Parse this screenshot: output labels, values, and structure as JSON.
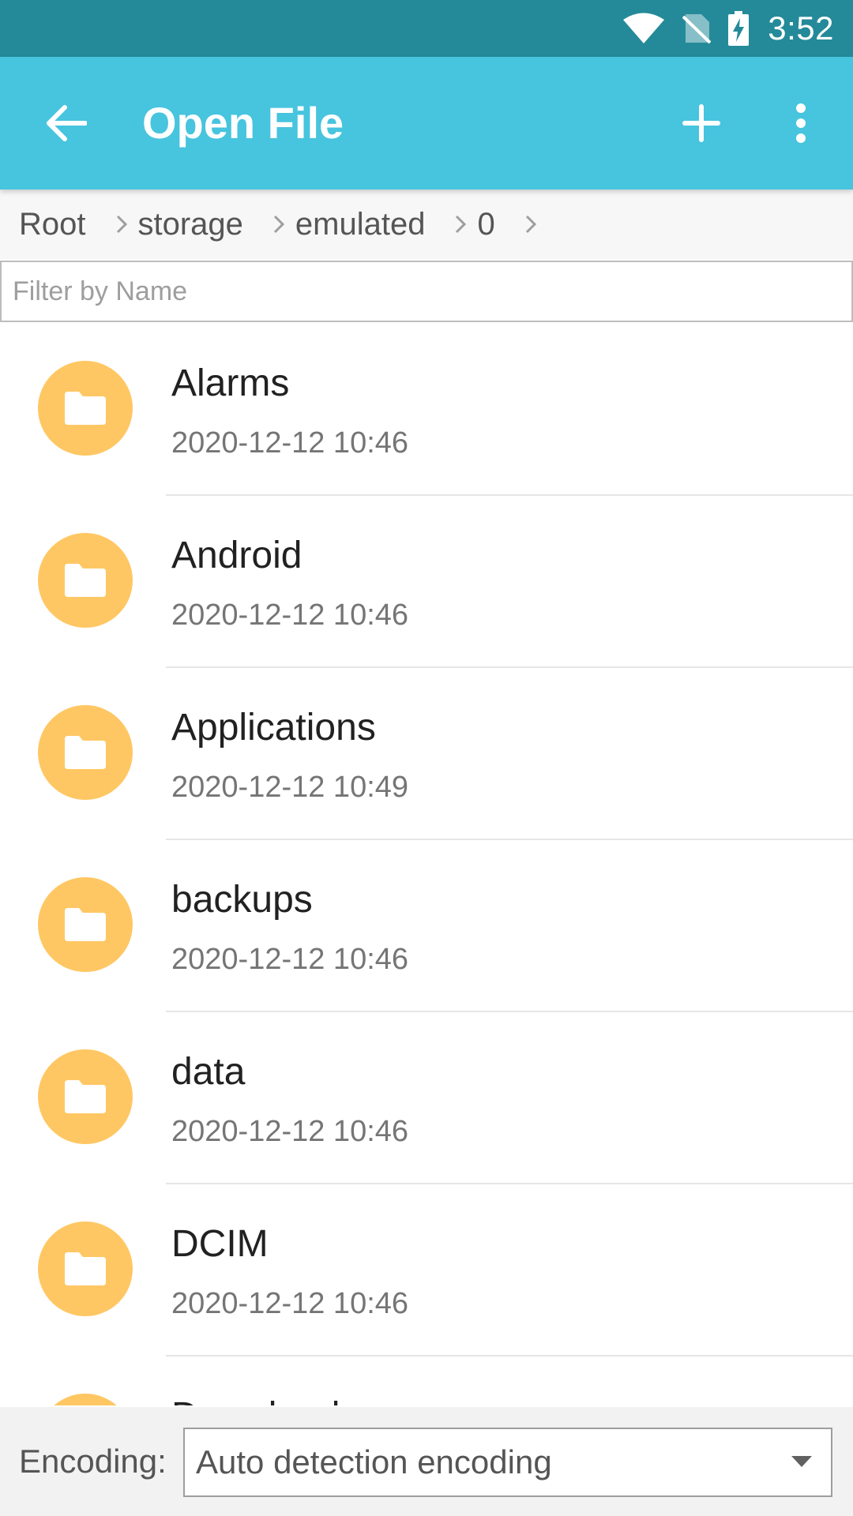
{
  "status_bar": {
    "time": "3:52",
    "icons": [
      "wifi-icon",
      "no-sim-icon",
      "battery-charging-icon"
    ]
  },
  "app_bar": {
    "title": "Open File",
    "back_icon": "arrow-back-icon",
    "add_icon": "plus-icon",
    "more_icon": "more-vert-icon"
  },
  "breadcrumb": {
    "items": [
      "Root",
      "storage",
      "emulated",
      "0"
    ],
    "separator_icon": "chevron-right-icon"
  },
  "filter": {
    "placeholder": "Filter by Name",
    "value": ""
  },
  "files": [
    {
      "name": "Alarms",
      "date": "2020-12-12 10:46",
      "icon": "folder-icon"
    },
    {
      "name": "Android",
      "date": "2020-12-12 10:46",
      "icon": "folder-icon"
    },
    {
      "name": "Applications",
      "date": "2020-12-12 10:49",
      "icon": "folder-icon"
    },
    {
      "name": "backups",
      "date": "2020-12-12 10:46",
      "icon": "folder-icon"
    },
    {
      "name": "data",
      "date": "2020-12-12 10:46",
      "icon": "folder-icon"
    },
    {
      "name": "DCIM",
      "date": "2020-12-12 10:46",
      "icon": "folder-icon"
    },
    {
      "name": "Download",
      "date": "",
      "icon": "folder-icon"
    }
  ],
  "encoding": {
    "label": "Encoding:",
    "selected": "Auto detection encoding",
    "arrow_icon": "dropdown-arrow-icon"
  },
  "colors": {
    "status_bar": "#248a99",
    "app_bar": "#47c4de",
    "folder": "#ffc763"
  }
}
